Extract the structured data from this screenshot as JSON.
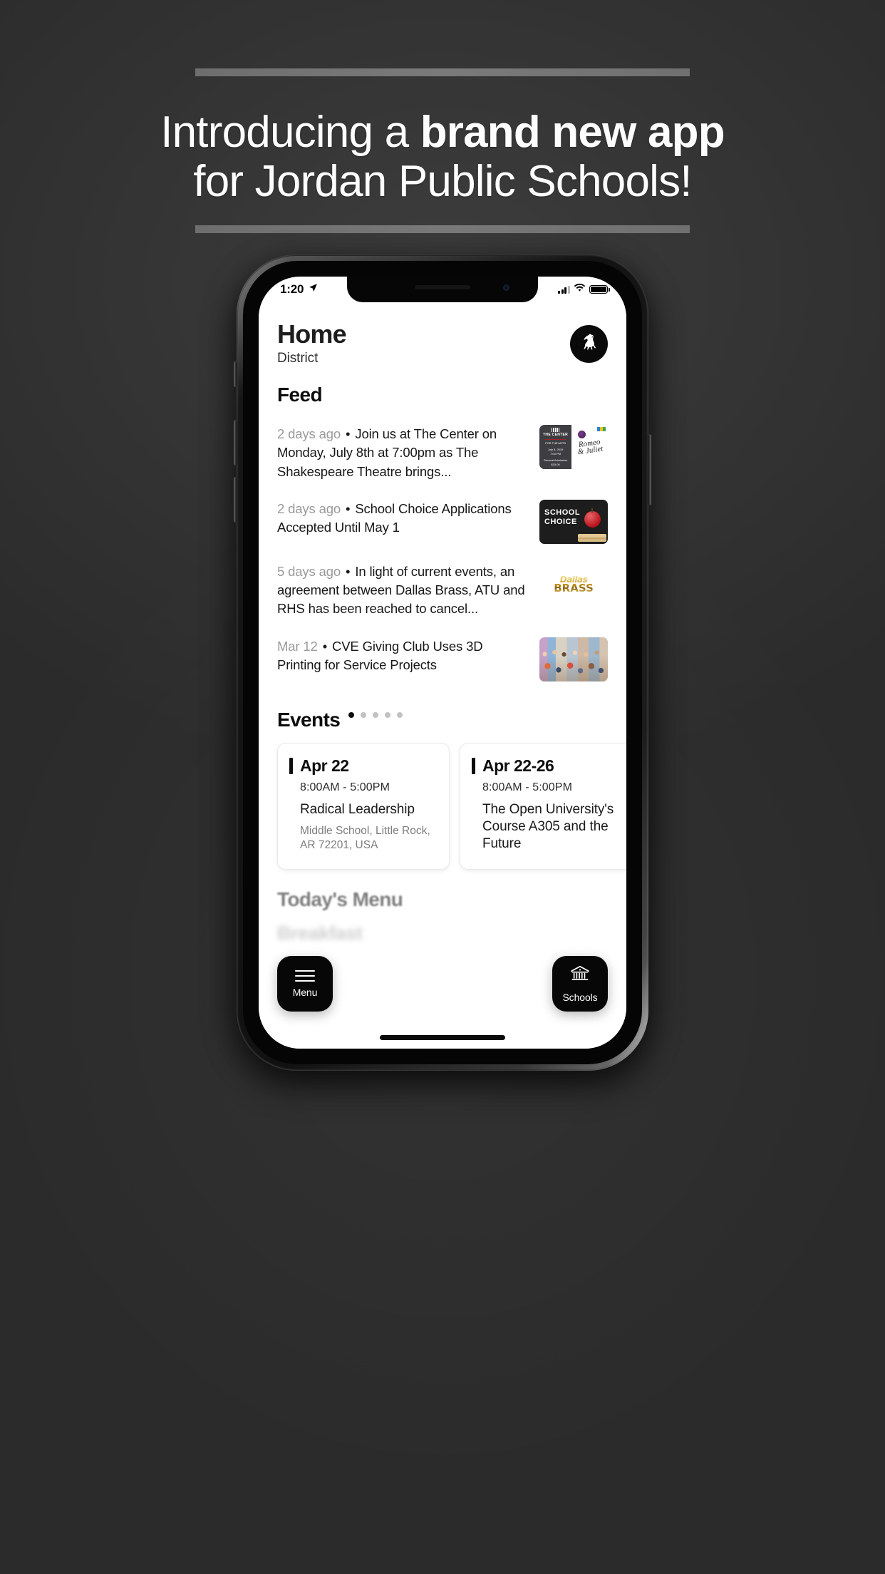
{
  "poster": {
    "headline_line1_normal": "Introducing a ",
    "headline_line1_bold": "brand new app",
    "headline_line2": "for Jordan Public Schools!"
  },
  "phone": {
    "status_bar": {
      "time": "1:20",
      "location_icon": "location-arrow-icon",
      "signal_icon": "cellular-signal-icon",
      "wifi_icon": "wifi-icon",
      "battery_icon": "battery-full-icon"
    },
    "app": {
      "header": {
        "title": "Home",
        "subtitle": "District",
        "avatar_icon": "horse-logo-icon"
      },
      "feed": {
        "title": "Feed",
        "items": [
          {
            "time": "2 days ago",
            "separator": "•",
            "text": "Join us at The Center on Monday, July 8th at 7:00pm as The Shakespeare Theatre brings...",
            "thumb": "romeo-and-juliet-ticket-thumbnail",
            "thumb_text": {
              "venue": "THE CENTER",
              "venue_sub": "FOR THE ARTS",
              "date": "July 8, 2019",
              "time": "7:00 PM",
              "admission": "General Admission",
              "price": "$15.00",
              "title_l1": "Romeo",
              "title_l2": "& Juliet"
            }
          },
          {
            "time": "2 days ago",
            "separator": "•",
            "text": "School Choice Applications Accepted Until May 1",
            "thumb": "school-choice-chalkboard-thumbnail",
            "thumb_text": {
              "line1": "SCHOOL",
              "line2": "CHOICE"
            }
          },
          {
            "time": "5 days ago",
            "separator": "•",
            "text": "In light of current events, an agreement between Dallas Brass, ATU and RHS has been reached to cancel...",
            "thumb": "dallas-brass-logo-thumbnail",
            "thumb_text": {
              "line1": "Dallas",
              "line2": "BRASS"
            }
          },
          {
            "time": "Mar 12",
            "separator": "•",
            "text": "CVE Giving Club Uses 3D Printing for Service Projects",
            "thumb": "students-group-photo-thumbnail",
            "thumb_text": null
          }
        ]
      },
      "events": {
        "title": "Events",
        "page_dots_total": 5,
        "page_dots_active_index": 0,
        "cards": [
          {
            "date": "Apr 22",
            "time": "8:00AM  -  5:00PM",
            "name": "Radical Leadership",
            "location": "Middle School, Little Rock, AR 72201, USA"
          },
          {
            "date": "Apr 22-26",
            "time": "8:00AM  -  5:00PM",
            "name": "The Open University's Course A305 and the Future",
            "location": ""
          }
        ]
      },
      "menu": {
        "title": "Today's Menu",
        "meal": "Breakfast"
      },
      "fabs": [
        {
          "label": "Menu",
          "icon": "hamburger-menu-icon"
        },
        {
          "label": "Schools",
          "icon": "school-building-icon"
        }
      ]
    }
  },
  "colors": {
    "poster_bg": "#363636",
    "rule": "#737373",
    "headline_text": "#fdfdfd",
    "app_accent": "#0d0d0d",
    "muted_text": "#9a9a9a"
  }
}
